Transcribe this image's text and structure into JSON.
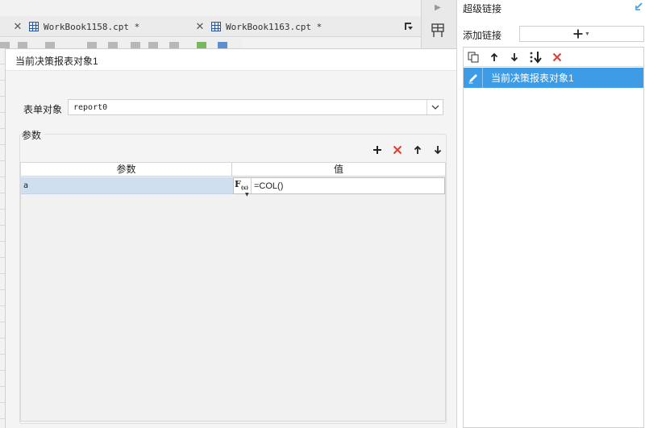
{
  "tabs": [
    {
      "label": "WorkBook1158.cpt *"
    },
    {
      "label": "WorkBook1163.cpt *"
    }
  ],
  "dialog": {
    "title": "当前决策报表对象1",
    "form_label": "表单对象",
    "form_value": "report0",
    "param_group_label": "参数",
    "table": {
      "headers": [
        "参数",
        "值"
      ],
      "rows": [
        {
          "param": "a",
          "value": "=COL()"
        }
      ]
    }
  },
  "hyperlink_panel": {
    "title": "超级链接",
    "add_label": "添加链接",
    "items": [
      {
        "label": "当前决策报表对象1",
        "selected": true
      }
    ]
  },
  "colors": {
    "selection_blue": "#3d9ce5",
    "row_highlight": "#cfdff0",
    "delete_red": "#e03c31"
  },
  "icons": [
    "close-icon",
    "workbook-icon",
    "tab-menu-icon",
    "add-icon",
    "delete-icon",
    "move-up-icon",
    "move-down-icon",
    "copy-icon",
    "sort-icon",
    "edit-icon",
    "dropdown-arrow-icon",
    "formula-icon"
  ]
}
